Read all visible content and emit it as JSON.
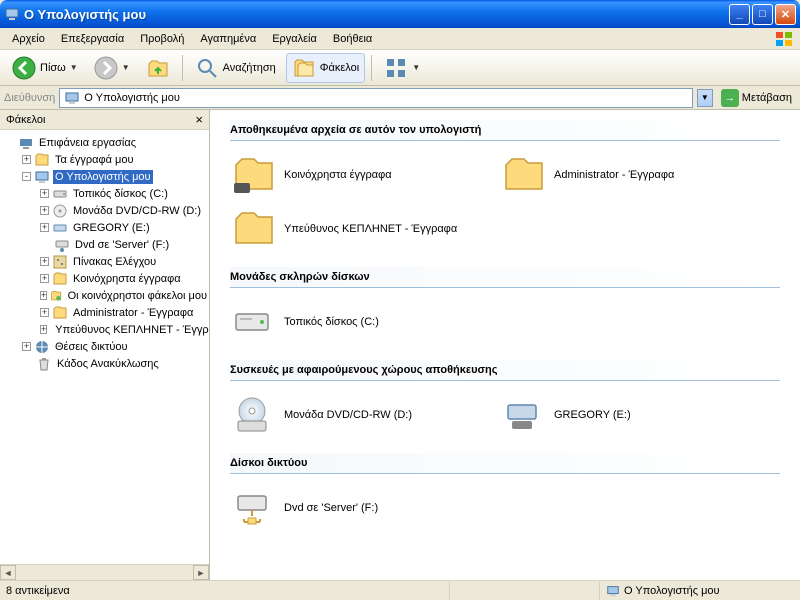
{
  "window": {
    "title": "Ο Υπολογιστής μου"
  },
  "menu": {
    "file": "Αρχείο",
    "edit": "Επεξεργασία",
    "view": "Προβολή",
    "favorites": "Αγαπημένα",
    "tools": "Εργαλεία",
    "help": "Βοήθεια"
  },
  "toolbar": {
    "back": "Πίσω",
    "search": "Αναζήτηση",
    "folders": "Φάκελοι"
  },
  "address": {
    "label": "Διεύθυνση",
    "value": "Ο Υπολογιστής μου",
    "go": "Μετάβαση"
  },
  "sidebar": {
    "title": "Φάκελοι",
    "items": [
      {
        "label": "Επιφάνεια εργασίας",
        "indent": 0,
        "exp": "",
        "icon": "desktop"
      },
      {
        "label": "Τα έγγραφά μου",
        "indent": 1,
        "exp": "+",
        "icon": "folder"
      },
      {
        "label": "Ο Υπολογιστής μου",
        "indent": 1,
        "exp": "-",
        "icon": "computer",
        "selected": true
      },
      {
        "label": "Τοπικός δίσκος (C:)",
        "indent": 2,
        "exp": "+",
        "icon": "hdd"
      },
      {
        "label": "Μονάδα DVD/CD-RW (D:)",
        "indent": 2,
        "exp": "+",
        "icon": "cd"
      },
      {
        "label": "GREGORY (E:)",
        "indent": 2,
        "exp": "+",
        "icon": "drive"
      },
      {
        "label": "Dvd σε 'Server' (F:)",
        "indent": 2,
        "exp": "",
        "icon": "netdrive"
      },
      {
        "label": "Πίνακας Ελέγχου",
        "indent": 2,
        "exp": "+",
        "icon": "cpanel"
      },
      {
        "label": "Κοινόχρηστα έγγραφα",
        "indent": 2,
        "exp": "+",
        "icon": "folder"
      },
      {
        "label": "Οι κοινόχρηστοι φάκελοι μου",
        "indent": 2,
        "exp": "+",
        "icon": "shared"
      },
      {
        "label": "Administrator - Έγγραφα",
        "indent": 2,
        "exp": "+",
        "icon": "folder"
      },
      {
        "label": "Υπεύθυνος ΚΕΠΛΗΝΕΤ - Έγγρ",
        "indent": 2,
        "exp": "+",
        "icon": "folder"
      },
      {
        "label": "Θέσεις δικτύου",
        "indent": 1,
        "exp": "+",
        "icon": "network"
      },
      {
        "label": "Κάδος Ανακύκλωσης",
        "indent": 1,
        "exp": "",
        "icon": "recycle"
      }
    ]
  },
  "sections": [
    {
      "title": "Αποθηκευμένα αρχεία σε αυτόν τον υπολογιστή",
      "items": [
        {
          "label": "Κοινόχρηστα έγγραφα",
          "icon": "sharedfolder"
        },
        {
          "label": "Administrator - Έγγραφα",
          "icon": "folder"
        },
        {
          "label": "Υπεύθυνος ΚΕΠΛΗΝΕΤ - Έγγραφα",
          "icon": "folder"
        }
      ]
    },
    {
      "title": "Μονάδες σκληρών δίσκων",
      "items": [
        {
          "label": "Τοπικός δίσκος (C:)",
          "icon": "hdd"
        }
      ]
    },
    {
      "title": "Συσκευές με αφαιρούμενους χώρους αποθήκευσης",
      "items": [
        {
          "label": "Μονάδα DVD/CD-RW (D:)",
          "icon": "cd"
        },
        {
          "label": "GREGORY (E:)",
          "icon": "removable"
        }
      ]
    },
    {
      "title": "Δίσκοι δικτύου",
      "items": [
        {
          "label": "Dvd σε 'Server' (F:)",
          "icon": "netdrive"
        }
      ]
    }
  ],
  "status": {
    "count": "8 αντικείμενα",
    "location": "Ο Υπολογιστής μου"
  }
}
